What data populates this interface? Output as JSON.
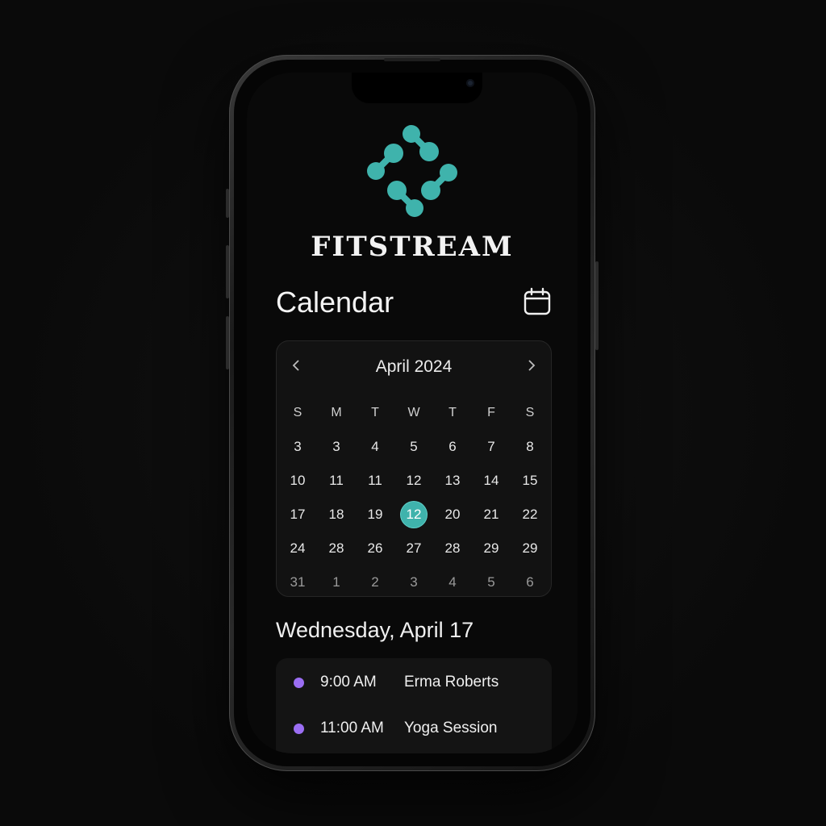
{
  "app": {
    "brand": "FITSTREAM",
    "logo_icon": "dumbbell-diamond-logo",
    "accent_color": "#3fb3ac"
  },
  "header": {
    "title": "Calendar",
    "calendar_icon": "calendar-icon"
  },
  "calendar": {
    "month_label": "April 2024",
    "prev_icon": "chevron-left-icon",
    "next_icon": "chevron-right-icon",
    "weekdays": [
      "S",
      "M",
      "T",
      "W",
      "T",
      "F",
      "S"
    ],
    "weeks": [
      [
        {
          "d": "3"
        },
        {
          "d": "3"
        },
        {
          "d": "4"
        },
        {
          "d": "5"
        },
        {
          "d": "6"
        },
        {
          "d": "7"
        },
        {
          "d": "8"
        }
      ],
      [
        {
          "d": "10"
        },
        {
          "d": "11"
        },
        {
          "d": "11"
        },
        {
          "d": "12"
        },
        {
          "d": "13"
        },
        {
          "d": "14"
        },
        {
          "d": "15"
        }
      ],
      [
        {
          "d": "17"
        },
        {
          "d": "18"
        },
        {
          "d": "19"
        },
        {
          "d": "12",
          "selected": true
        },
        {
          "d": "20"
        },
        {
          "d": "21"
        },
        {
          "d": "22"
        }
      ],
      [
        {
          "d": "24"
        },
        {
          "d": "28"
        },
        {
          "d": "26"
        },
        {
          "d": "27"
        },
        {
          "d": "28"
        },
        {
          "d": "29"
        },
        {
          "d": "29"
        }
      ],
      [
        {
          "d": "31",
          "muted": true
        },
        {
          "d": "1",
          "muted": true
        },
        {
          "d": "2",
          "muted": true
        },
        {
          "d": "3",
          "muted": true
        },
        {
          "d": "4",
          "muted": true
        },
        {
          "d": "5",
          "muted": true
        },
        {
          "d": "6",
          "muted": true
        }
      ]
    ]
  },
  "agenda": {
    "heading": "Wednesday, April 17",
    "events": [
      {
        "time": "9:00 AM",
        "title": "Erma Roberts",
        "dot_color": "#9b6ef3"
      },
      {
        "time": "11:00 AM",
        "title": "Yoga Session",
        "dot_color": "#9b6ef3"
      }
    ]
  }
}
